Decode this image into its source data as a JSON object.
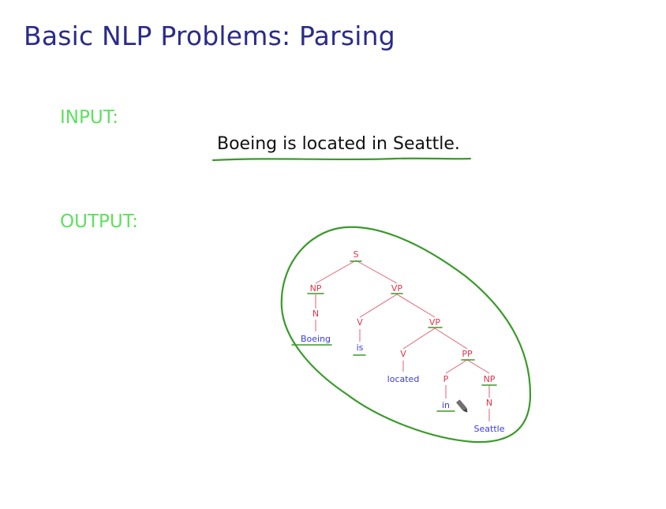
{
  "slide": {
    "title": "Basic NLP Problems: Parsing",
    "input_label": "INPUT:",
    "sentence": "Boeing is located in Seattle.",
    "output_label": "OUTPUT:"
  },
  "tree": {
    "nodes": {
      "S": "S",
      "NP1": "NP",
      "VP1": "VP",
      "N1": "N",
      "V1": "V",
      "VP2": "VP",
      "V2": "V",
      "PP": "PP",
      "P": "P",
      "NP2": "NP",
      "N2": "N"
    },
    "words": {
      "w1": "Boeing",
      "w2": "is",
      "w3": "located",
      "w4": "in",
      "w5": "Seattle"
    }
  },
  "colors": {
    "title": "#2b2b8a",
    "label": "#5ee05e",
    "annotation": "#3a9a2a",
    "tree_node": "#e0344a",
    "tree_word": "#3a3ae0"
  }
}
